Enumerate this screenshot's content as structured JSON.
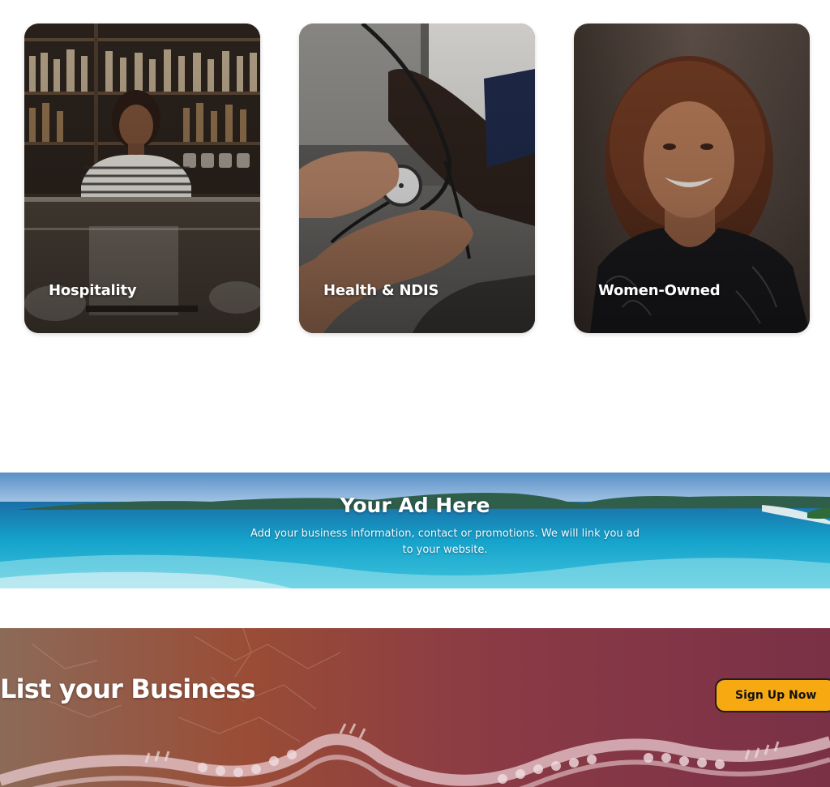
{
  "categories": [
    {
      "label": "Hospitality"
    },
    {
      "label": "Health & NDIS"
    },
    {
      "label": "Women-Owned"
    }
  ],
  "ad_banner": {
    "title": "Your Ad Here",
    "description": "Add your business information, contact or promotions. We will link you ad to your website."
  },
  "listing": {
    "title": "List your Business",
    "button_label": "Sign Up Now"
  },
  "colors": {
    "button_bg": "#f7a912",
    "button_border": "#1d1d1d",
    "listing_bg_left": "#8a4a35",
    "listing_bg_right": "#7e3347",
    "ad_sea": "#1aa6c8"
  }
}
